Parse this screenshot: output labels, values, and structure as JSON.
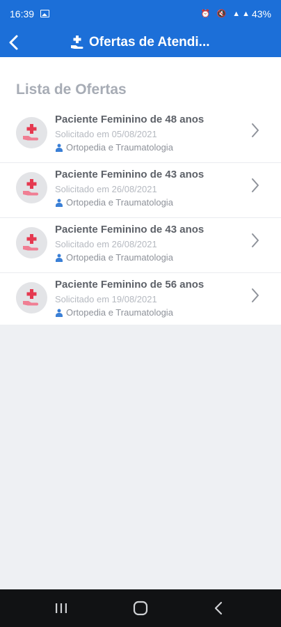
{
  "status_bar": {
    "time": "16:39",
    "battery": "43%"
  },
  "header": {
    "title": "Ofertas de Atendi..."
  },
  "section_title": "Lista de Ofertas",
  "offers": [
    {
      "name": "Paciente Feminino de 48 anos",
      "date": "Solicitado em 05/08/2021",
      "specialty": "Ortopedia e Traumatologia"
    },
    {
      "name": "Paciente Feminino de 43 anos",
      "date": "Solicitado em 26/08/2021",
      "specialty": "Ortopedia e Traumatologia"
    },
    {
      "name": "Paciente Feminino de 43 anos",
      "date": "Solicitado em 26/08/2021",
      "specialty": "Ortopedia e Traumatologia"
    },
    {
      "name": "Paciente Feminino de 56 anos",
      "date": "Solicitado em 19/08/2021",
      "specialty": "Ortopedia e Traumatologia"
    }
  ],
  "colors": {
    "primary": "#1c6fd8",
    "accent_red": "#e53950",
    "accent_pink": "#f07e93"
  }
}
